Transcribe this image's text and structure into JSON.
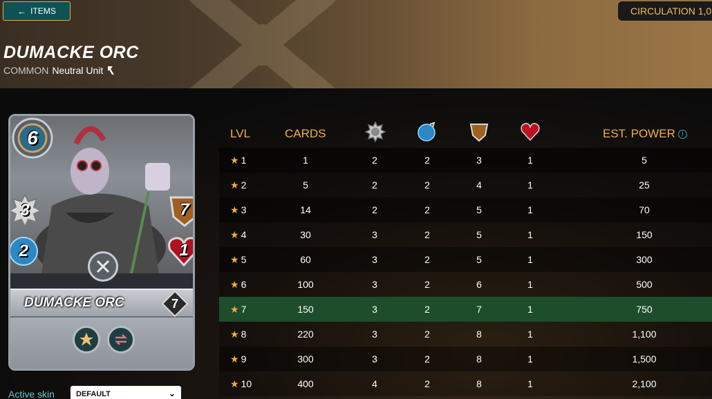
{
  "header": {
    "back_label": "ITEMS",
    "circulation": "CIRCULATION 1,0",
    "card_name": "DUMACKE ORC",
    "rarity": "COMMON",
    "type": "Neutral Unit"
  },
  "card": {
    "name": "DUMACKE ORC",
    "mana": "6",
    "level": "7",
    "melee": "3",
    "magic": "2",
    "armor": "7",
    "health": "1"
  },
  "skin": {
    "label": "Active skin",
    "selected": "DEFAULT"
  },
  "table": {
    "headers": {
      "lvl": "LVL",
      "cards": "CARDS",
      "power": "EST. POWER"
    },
    "rows": [
      {
        "lvl": "1",
        "cards": "1",
        "melee": "2",
        "magic": "2",
        "armor": "3",
        "health": "1",
        "power": "5"
      },
      {
        "lvl": "2",
        "cards": "5",
        "melee": "2",
        "magic": "2",
        "armor": "4",
        "health": "1",
        "power": "25"
      },
      {
        "lvl": "3",
        "cards": "14",
        "melee": "2",
        "magic": "2",
        "armor": "5",
        "health": "1",
        "power": "70"
      },
      {
        "lvl": "4",
        "cards": "30",
        "melee": "3",
        "magic": "2",
        "armor": "5",
        "health": "1",
        "power": "150"
      },
      {
        "lvl": "5",
        "cards": "60",
        "melee": "3",
        "magic": "2",
        "armor": "5",
        "health": "1",
        "power": "300"
      },
      {
        "lvl": "6",
        "cards": "100",
        "melee": "3",
        "magic": "2",
        "armor": "6",
        "health": "1",
        "power": "500"
      },
      {
        "lvl": "7",
        "cards": "150",
        "melee": "3",
        "magic": "2",
        "armor": "7",
        "health": "1",
        "power": "750"
      },
      {
        "lvl": "8",
        "cards": "220",
        "melee": "3",
        "magic": "2",
        "armor": "8",
        "health": "1",
        "power": "1,100"
      },
      {
        "lvl": "9",
        "cards": "300",
        "melee": "3",
        "magic": "2",
        "armor": "8",
        "health": "1",
        "power": "1,500"
      },
      {
        "lvl": "10",
        "cards": "400",
        "melee": "4",
        "magic": "2",
        "armor": "8",
        "health": "1",
        "power": "2,100"
      }
    ]
  },
  "colors": {
    "accent_gold": "#f0b040",
    "highlight_row": "#1e4d2c",
    "back_button_bg": "#0e5254"
  }
}
